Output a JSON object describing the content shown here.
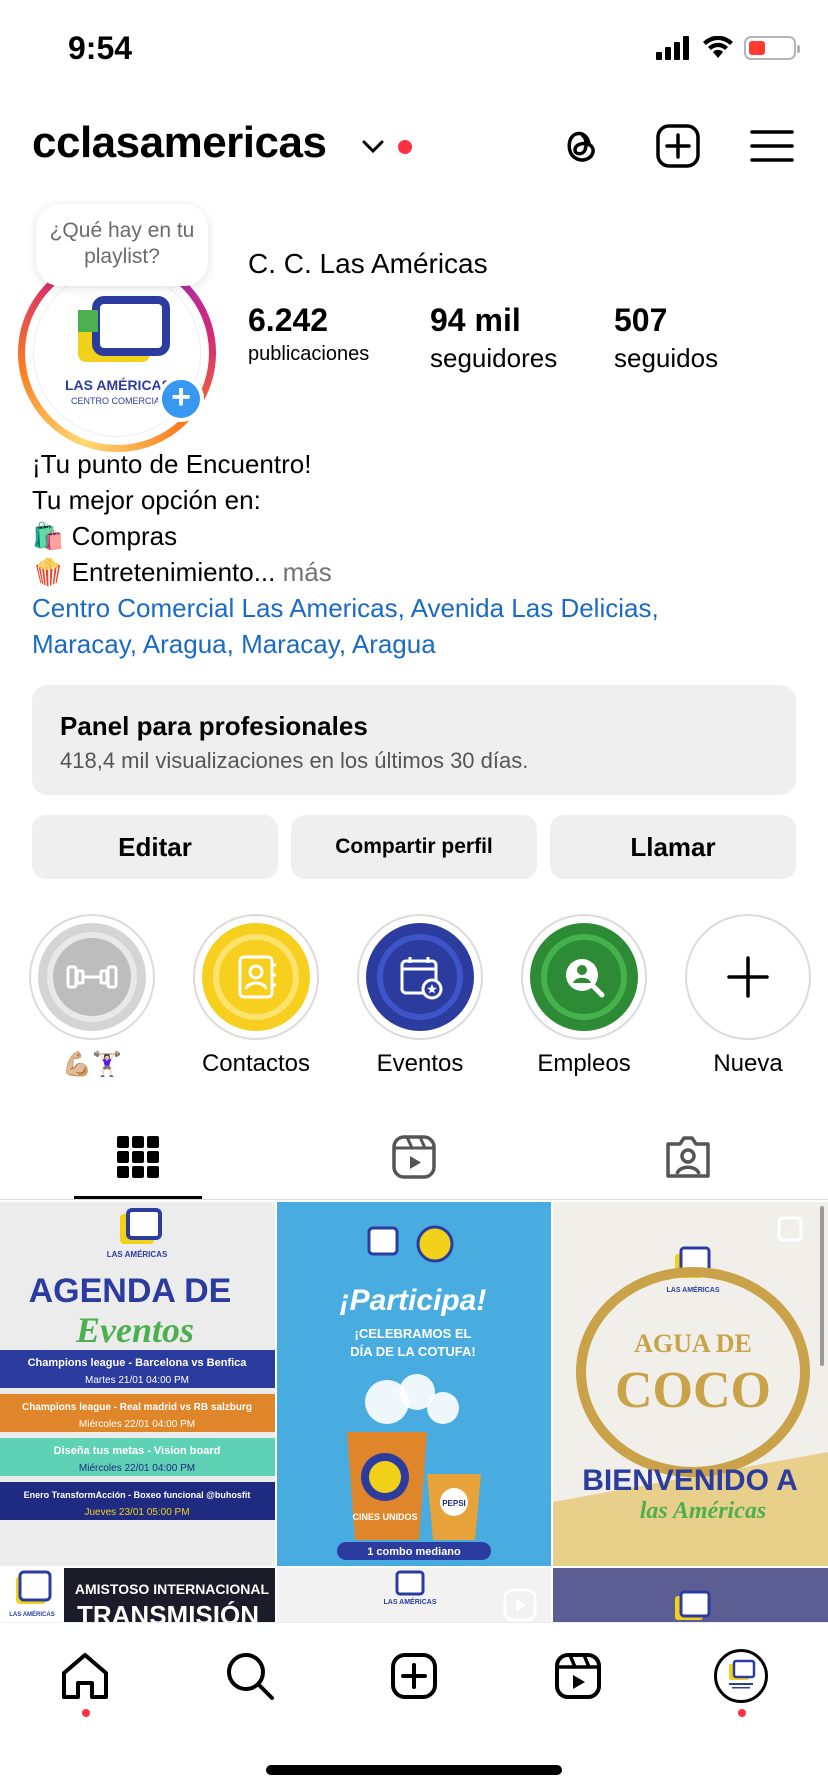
{
  "status_bar": {
    "time": "9:54"
  },
  "header": {
    "username": "cclasamericas"
  },
  "profile": {
    "note": "¿Qué hay en tu playlist?",
    "avatar_brand": "LAS AMÉRICAS",
    "avatar_sub": "CENTRO COMERCIAL",
    "display_name": "C. C. Las Américas",
    "stats": [
      {
        "value": "6.242",
        "label": "publicaciones"
      },
      {
        "value": "94 mil",
        "label": "seguidores"
      },
      {
        "value": "507",
        "label": "seguidos"
      }
    ],
    "bio": {
      "line1": "¡Tu punto de Encuentro!",
      "line2": "Tu mejor opción en:",
      "line3_emoji": "🛍️",
      "line3": "Compras",
      "line4_emoji": "🍿",
      "line4": "Entretenimiento...",
      "more": "más",
      "location_line1": "Centro Comercial Las Americas, Avenida Las Delicias,",
      "location_line2": "Maracay, Aragua, Maracay, Aragua"
    }
  },
  "panel": {
    "title": "Panel para profesionales",
    "subtitle": "418,4 mil visualizaciones en los últimos 30 días."
  },
  "buttons": {
    "edit": "Editar",
    "share": "Compartir perfil",
    "call": "Llamar"
  },
  "highlights": [
    {
      "label": "💪🏼🏋🏻‍♀️",
      "icon": "dumbbell-icon",
      "color": "#bdbdbd"
    },
    {
      "label": "Contactos",
      "icon": "contact-book-icon",
      "color": "#f7cf1f"
    },
    {
      "label": "Eventos",
      "icon": "calendar-icon",
      "color": "#2b3c9e"
    },
    {
      "label": "Empleos",
      "icon": "job-search-icon",
      "color": "#2e8b35"
    },
    {
      "label": "Nueva",
      "icon": "plus-icon",
      "color": "#ffffff"
    }
  ],
  "posts": {
    "p1": {
      "brand": "LAS AMÉRICAS",
      "title1": "AGENDA DE",
      "title2": "Eventos",
      "rows": [
        {
          "title": "Champions league - Barcelona vs Benfica",
          "date": "Martes 21/01",
          "time": "04:00 PM"
        },
        {
          "title": "Champions league - Real madrid vs RB salzburg",
          "date": "Miércoles 22/01",
          "time": "04:00 PM"
        },
        {
          "title": "Diseña tus metas - Vision board",
          "date": "Miércoles 22/01",
          "time": "04:00 PM"
        },
        {
          "title": "Enero TransformAcción - Boxeo funcional @buhosfit",
          "date": "Jueves 23/01",
          "time": "05:00 PM"
        }
      ]
    },
    "p2": {
      "title": "¡Participa!",
      "sub1": "¡CELEBRAMOS EL",
      "sub2": "DÍA DE LA COTUFA!",
      "cines": "CINES UNIDOS",
      "pepsi": "PEPSI",
      "combo": "1 combo mediano"
    },
    "p3": {
      "brand": "LAS AMÉRICAS",
      "sign1": "AGUA DE",
      "sign2": "COCO",
      "welcome1": "BIENVENIDO A",
      "welcome2": "las Américas"
    },
    "p4": {
      "brand": "LAS AMÉRICAS",
      "line1": "AMISTOSO INTERNACIONAL",
      "line2": "TRANSMISIÓN"
    },
    "p5": {
      "brand": "LAS AMÉRICAS"
    }
  },
  "colors": {
    "link": "#1a6ac6",
    "notification": "#ff3040",
    "add_story": "#3897f0",
    "brand_yellow": "#f2d11b",
    "brand_blue": "#2b3c9e",
    "brand_green": "#4caf50"
  }
}
